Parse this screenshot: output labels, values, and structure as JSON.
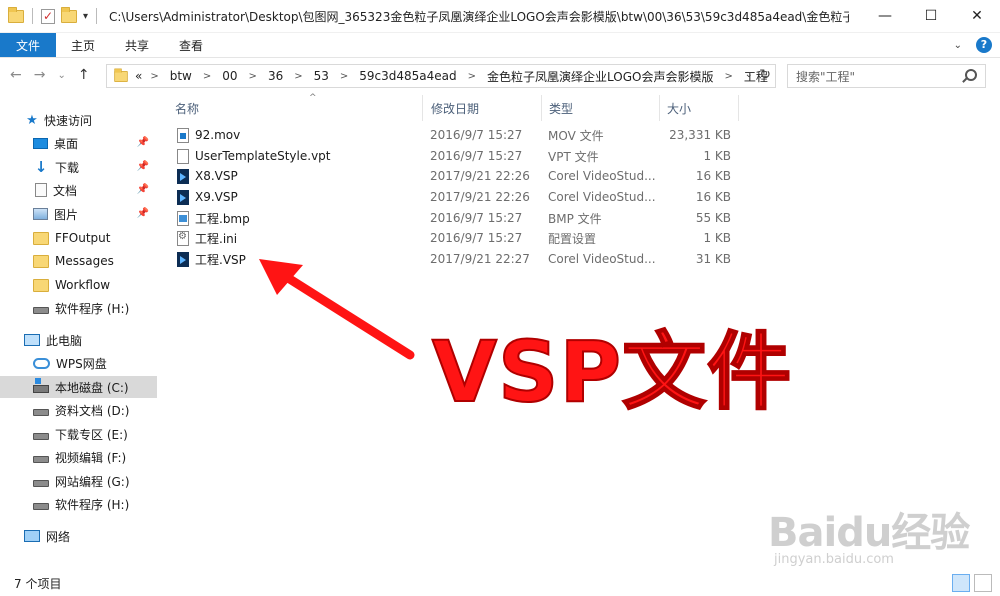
{
  "titlebar": {
    "path": "C:\\Users\\Administrator\\Desktop\\包图网_365323金色粒子凤凰演绎企业LOGO会声会影模版\\btw\\00\\36\\53\\59c3d485a4ead\\金色粒子凤...",
    "minimize": "—",
    "maximize": "☐",
    "close": "✕"
  },
  "ribbon": {
    "file": "文件",
    "tabs": [
      "主页",
      "共享",
      "查看"
    ]
  },
  "address": {
    "overflow": "«",
    "crumbs": [
      "btw",
      "00",
      "36",
      "53",
      "59c3d485a4ead",
      "金色粒子凤凰演绎企业LOGO会声会影模版",
      "工程"
    ]
  },
  "search": {
    "placeholder": "搜索\"工程\""
  },
  "sidebar": {
    "quick_access": "快速访问",
    "items": [
      {
        "label": "桌面",
        "icon": "desktop-icon"
      },
      {
        "label": "下载",
        "icon": "download-icon"
      },
      {
        "label": "文档",
        "icon": "document-icon"
      },
      {
        "label": "图片",
        "icon": "picture-icon"
      },
      {
        "label": "FFOutput",
        "icon": "folder-icon"
      },
      {
        "label": "Messages",
        "icon": "folder-icon"
      },
      {
        "label": "Workflow",
        "icon": "folder-icon"
      },
      {
        "label": "软件程序 (H:)",
        "icon": "drive-icon"
      }
    ],
    "this_pc": "此电脑",
    "pc_items": [
      {
        "label": "WPS网盘",
        "icon": "cloud-icon"
      },
      {
        "label": "本地磁盘 (C:)",
        "icon": "drive-icon"
      },
      {
        "label": "资料文档 (D:)",
        "icon": "drive-icon"
      },
      {
        "label": "下载专区 (E:)",
        "icon": "drive-icon"
      },
      {
        "label": "视频编辑 (F:)",
        "icon": "drive-icon"
      },
      {
        "label": "网站编程 (G:)",
        "icon": "drive-icon"
      },
      {
        "label": "软件程序 (H:)",
        "icon": "drive-icon"
      }
    ],
    "network": "网络"
  },
  "columns": {
    "name": "名称",
    "date": "修改日期",
    "type": "类型",
    "size": "大小"
  },
  "files": [
    {
      "name": "92.mov",
      "date": "2016/9/7 15:27",
      "type": "MOV 文件",
      "size": "23,331 KB",
      "icon": "mov-file-icon"
    },
    {
      "name": "UserTemplateStyle.vpt",
      "date": "2016/9/7 15:27",
      "type": "VPT 文件",
      "size": "1 KB",
      "icon": "file-icon"
    },
    {
      "name": "X8.VSP",
      "date": "2017/9/21 22:26",
      "type": "Corel VideoStud...",
      "size": "16 KB",
      "icon": "vsp-file-icon"
    },
    {
      "name": "X9.VSP",
      "date": "2017/9/21 22:26",
      "type": "Corel VideoStud...",
      "size": "16 KB",
      "icon": "vsp-file-icon"
    },
    {
      "name": "工程.bmp",
      "date": "2016/9/7 15:27",
      "type": "BMP 文件",
      "size": "55 KB",
      "icon": "bmp-file-icon"
    },
    {
      "name": "工程.ini",
      "date": "2016/9/7 15:27",
      "type": "配置设置",
      "size": "1 KB",
      "icon": "ini-file-icon"
    },
    {
      "name": "工程.VSP",
      "date": "2017/9/21 22:27",
      "type": "Corel VideoStud...",
      "size": "31 KB",
      "icon": "vsp-file-icon"
    }
  ],
  "annotation": {
    "text": "VSP文件",
    "color": "#ff1414"
  },
  "watermark": {
    "logo": "Baidu经验",
    "url": "jingyan.baidu.com"
  },
  "status": {
    "count": "7 个项目"
  },
  "colors": {
    "accent": "#1979ca",
    "selected": "#d9d9d9"
  }
}
